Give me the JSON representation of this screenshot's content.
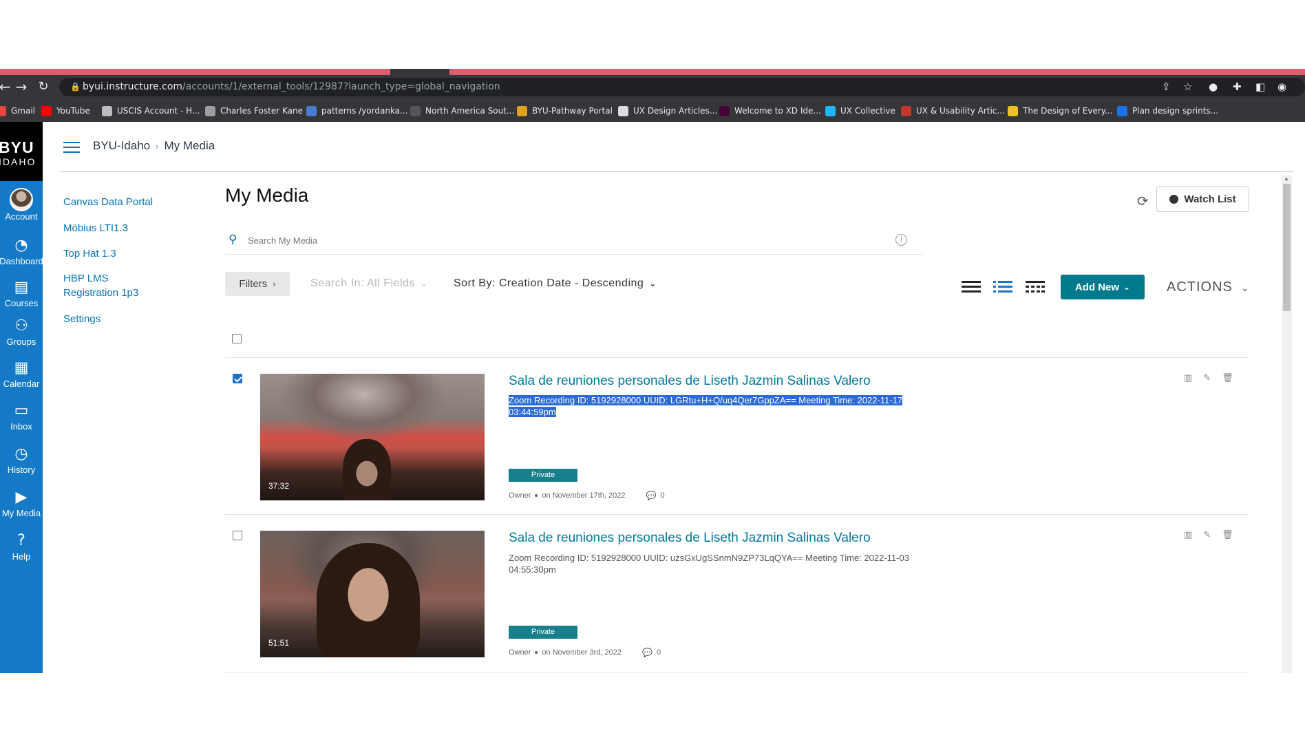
{
  "browser": {
    "url_host": "byui.instructure.com",
    "url_path": "/accounts/1/external_tools/12987?launch_type=global_navigation",
    "bookmarks": [
      {
        "label": "Gmail",
        "color": "#e8453c"
      },
      {
        "label": "YouTube",
        "color": "#ff0000"
      },
      {
        "label": "USCIS Account - H...",
        "color": "#bcbcbc"
      },
      {
        "label": "Charles Foster Kane",
        "color": "#9e9e9e"
      },
      {
        "label": "patterns /yordanka...",
        "color": "#4a7bd0"
      },
      {
        "label": "North America Sout...",
        "color": "#555555"
      },
      {
        "label": "BYU-Pathway Portal",
        "color": "#e0a020"
      },
      {
        "label": "UX Design Articles...",
        "color": "#dddddd"
      },
      {
        "label": "Welcome to XD Ide...",
        "color": "#470137"
      },
      {
        "label": "UX Collective",
        "color": "#1fb8ff"
      },
      {
        "label": "UX & Usability Artic...",
        "color": "#c2362b"
      },
      {
        "label": "The Design of Every...",
        "color": "#f0c020"
      },
      {
        "label": "Plan design sprints...",
        "color": "#1a73e8"
      }
    ]
  },
  "global_nav": {
    "logo_top": "BYU",
    "logo_bottom": "IDAHO",
    "items": [
      {
        "label": "Account",
        "icon": "account-avatar"
      },
      {
        "label": "Dashboard",
        "icon": "dashboard-icon"
      },
      {
        "label": "Courses",
        "icon": "courses-icon"
      },
      {
        "label": "Groups",
        "icon": "groups-icon"
      },
      {
        "label": "Calendar",
        "icon": "calendar-icon"
      },
      {
        "label": "Inbox",
        "icon": "inbox-icon"
      },
      {
        "label": "History",
        "icon": "history-icon"
      },
      {
        "label": "My Media",
        "icon": "media-icon"
      },
      {
        "label": "Help",
        "icon": "help-icon"
      }
    ]
  },
  "breadcrumb": {
    "root": "BYU-Idaho",
    "current": "My Media"
  },
  "course_nav": [
    "Canvas Data Portal",
    "Möbius LTI1.3",
    "Top Hat 1.3",
    "HBP LMS Registration 1p3",
    "Settings"
  ],
  "main": {
    "title": "My Media",
    "watch_list": "Watch List",
    "search_placeholder": "Search My Media",
    "filters": "Filters",
    "search_in": "Search In: All Fields",
    "sort_by": "Sort By: Creation Date - Descending",
    "add_new": "Add New",
    "actions": "ACTIONS",
    "accent": "#007a8c"
  },
  "entries": [
    {
      "title": "Sala de reuniones personales de Liseth Jazmin Salinas Valero",
      "description": "Zoom Recording ID: 5192928000 UUID: LGRtu+H+Q/uq4Qer7GppZA== Meeting Time: 2022-11-17 03:44:59pm",
      "duration": "37:32",
      "status": "Private",
      "owner": "Owner",
      "date": "on November 17th, 2022",
      "comments": "0",
      "checked": true
    },
    {
      "title": "Sala de reuniones personales de Liseth Jazmin Salinas Valero",
      "description": "Zoom Recording ID: 5192928000 UUID: uzsGxUgSSnmN9ZP73LqQYA== Meeting Time: 2022-11-03 04:55:30pm",
      "duration": "51:51",
      "status": "Private",
      "owner": "Owner",
      "date": "on November 3rd, 2022",
      "comments": "0",
      "checked": false
    }
  ]
}
